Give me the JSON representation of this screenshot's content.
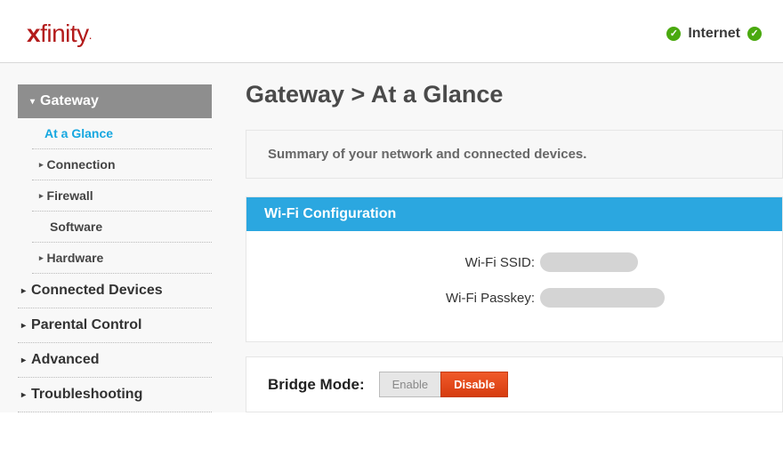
{
  "brand": "xfinity",
  "status": {
    "internet_label": "Internet"
  },
  "sidebar": {
    "gateway": {
      "label": "Gateway",
      "items": [
        {
          "label": "At a Glance",
          "active": true,
          "chevron": false
        },
        {
          "label": "Connection",
          "active": false,
          "chevron": true
        },
        {
          "label": "Firewall",
          "active": false,
          "chevron": true
        },
        {
          "label": "Software",
          "active": false,
          "chevron": false
        },
        {
          "label": "Hardware",
          "active": false,
          "chevron": true
        }
      ]
    },
    "sections": [
      {
        "label": "Connected Devices"
      },
      {
        "label": "Parental Control"
      },
      {
        "label": "Advanced"
      },
      {
        "label": "Troubleshooting"
      }
    ]
  },
  "page": {
    "title": "Gateway > At a Glance",
    "summary": "Summary of your network and connected devices.",
    "wifi": {
      "panel_title": "Wi-Fi Configuration",
      "ssid_label": "Wi-Fi SSID:",
      "pass_label": "Wi-Fi Passkey:"
    },
    "bridge": {
      "label": "Bridge Mode:",
      "enable": "Enable",
      "disable": "Disable"
    }
  }
}
